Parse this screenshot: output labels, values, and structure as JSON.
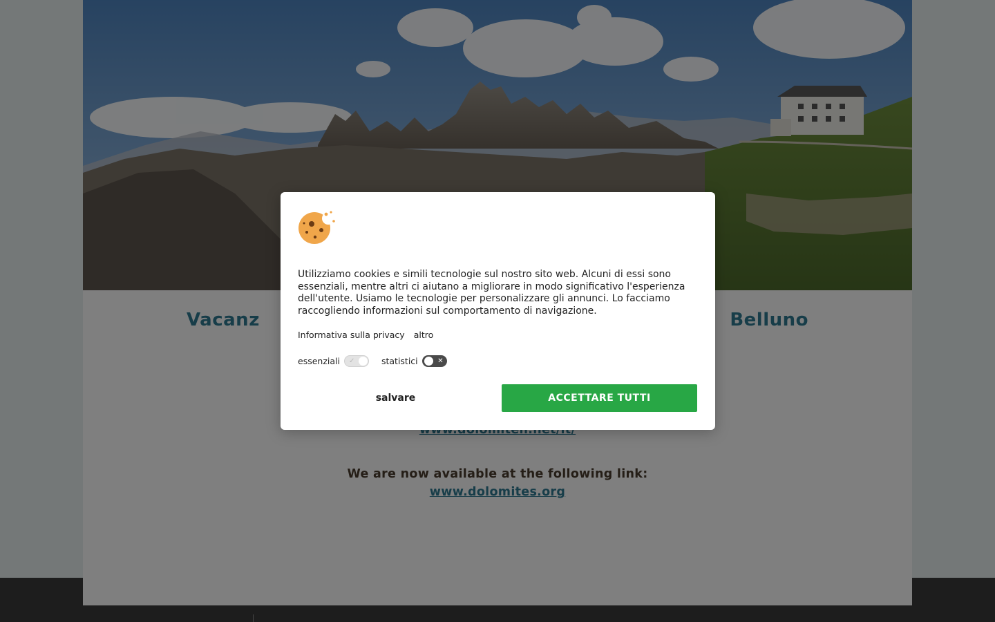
{
  "headline": {
    "left": "Vacanz",
    "right": "Belluno"
  },
  "notice_it": {
    "message": "",
    "link": "www.dolomiten.net/it/"
  },
  "notice_en": {
    "message": "We are now available at the following link:",
    "link": "www.dolomites.org"
  },
  "cookie_banner": {
    "icon": "cookie-icon",
    "text": "Utilizziamo cookies e simili tecnologie sul nostro sito web. Alcuni di essi sono essenziali, mentre altri ci aiutano a migliorare in modo significativo l'esperienza dell'utente. Usiamo le tecnologie per personalizzare gli annunci. Lo facciamo raccogliendo informazioni sul comportamento di navigazione.",
    "links": {
      "privacy": "Informativa sulla privacy",
      "more": "altro"
    },
    "toggles": {
      "essential_label": "essenziali",
      "essential_enabled": true,
      "statistics_label": "statistici",
      "statistics_enabled": false
    },
    "buttons": {
      "save": "salvare",
      "accept_all": "ACCETTARE TUTTI"
    },
    "colors": {
      "accept_button": "#28a745",
      "link_color": "#2f7a93"
    }
  }
}
